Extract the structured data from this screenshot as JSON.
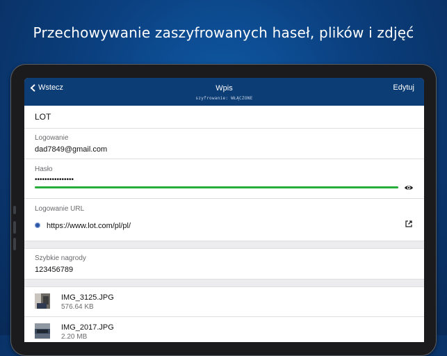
{
  "headline": "Przechowywanie zaszyfrowanych haseł, plików i zdjęć",
  "navbar": {
    "back_label": "Wstecz",
    "title": "Wpis",
    "subtitle": "szyfrowanie: WŁĄCZONE",
    "edit_label": "Edytuj"
  },
  "entry": {
    "name": "LOT",
    "login_label": "Logowanie",
    "login_value": "dad7849@gmail.com",
    "password_label": "Hasło",
    "password_value": "••••••••••••••••",
    "password_strength": 1.0,
    "url_label": "Logowanie URL",
    "url_value": "https://www.lot.com/pl/pl/",
    "rewards_label": "Szybkie nagrody",
    "rewards_value": "123456789"
  },
  "attachments": [
    {
      "name": "IMG_3125.JPG",
      "size": "576.64 KB"
    },
    {
      "name": "IMG_2017.JPG",
      "size": "2.20 MB"
    }
  ],
  "colors": {
    "background": "#0b3f7e",
    "navbar": "#0c3d74",
    "strength": "#27ad3a"
  },
  "icons": [
    "back-chevron-icon",
    "eye-icon",
    "globe-icon",
    "external-link-icon"
  ]
}
